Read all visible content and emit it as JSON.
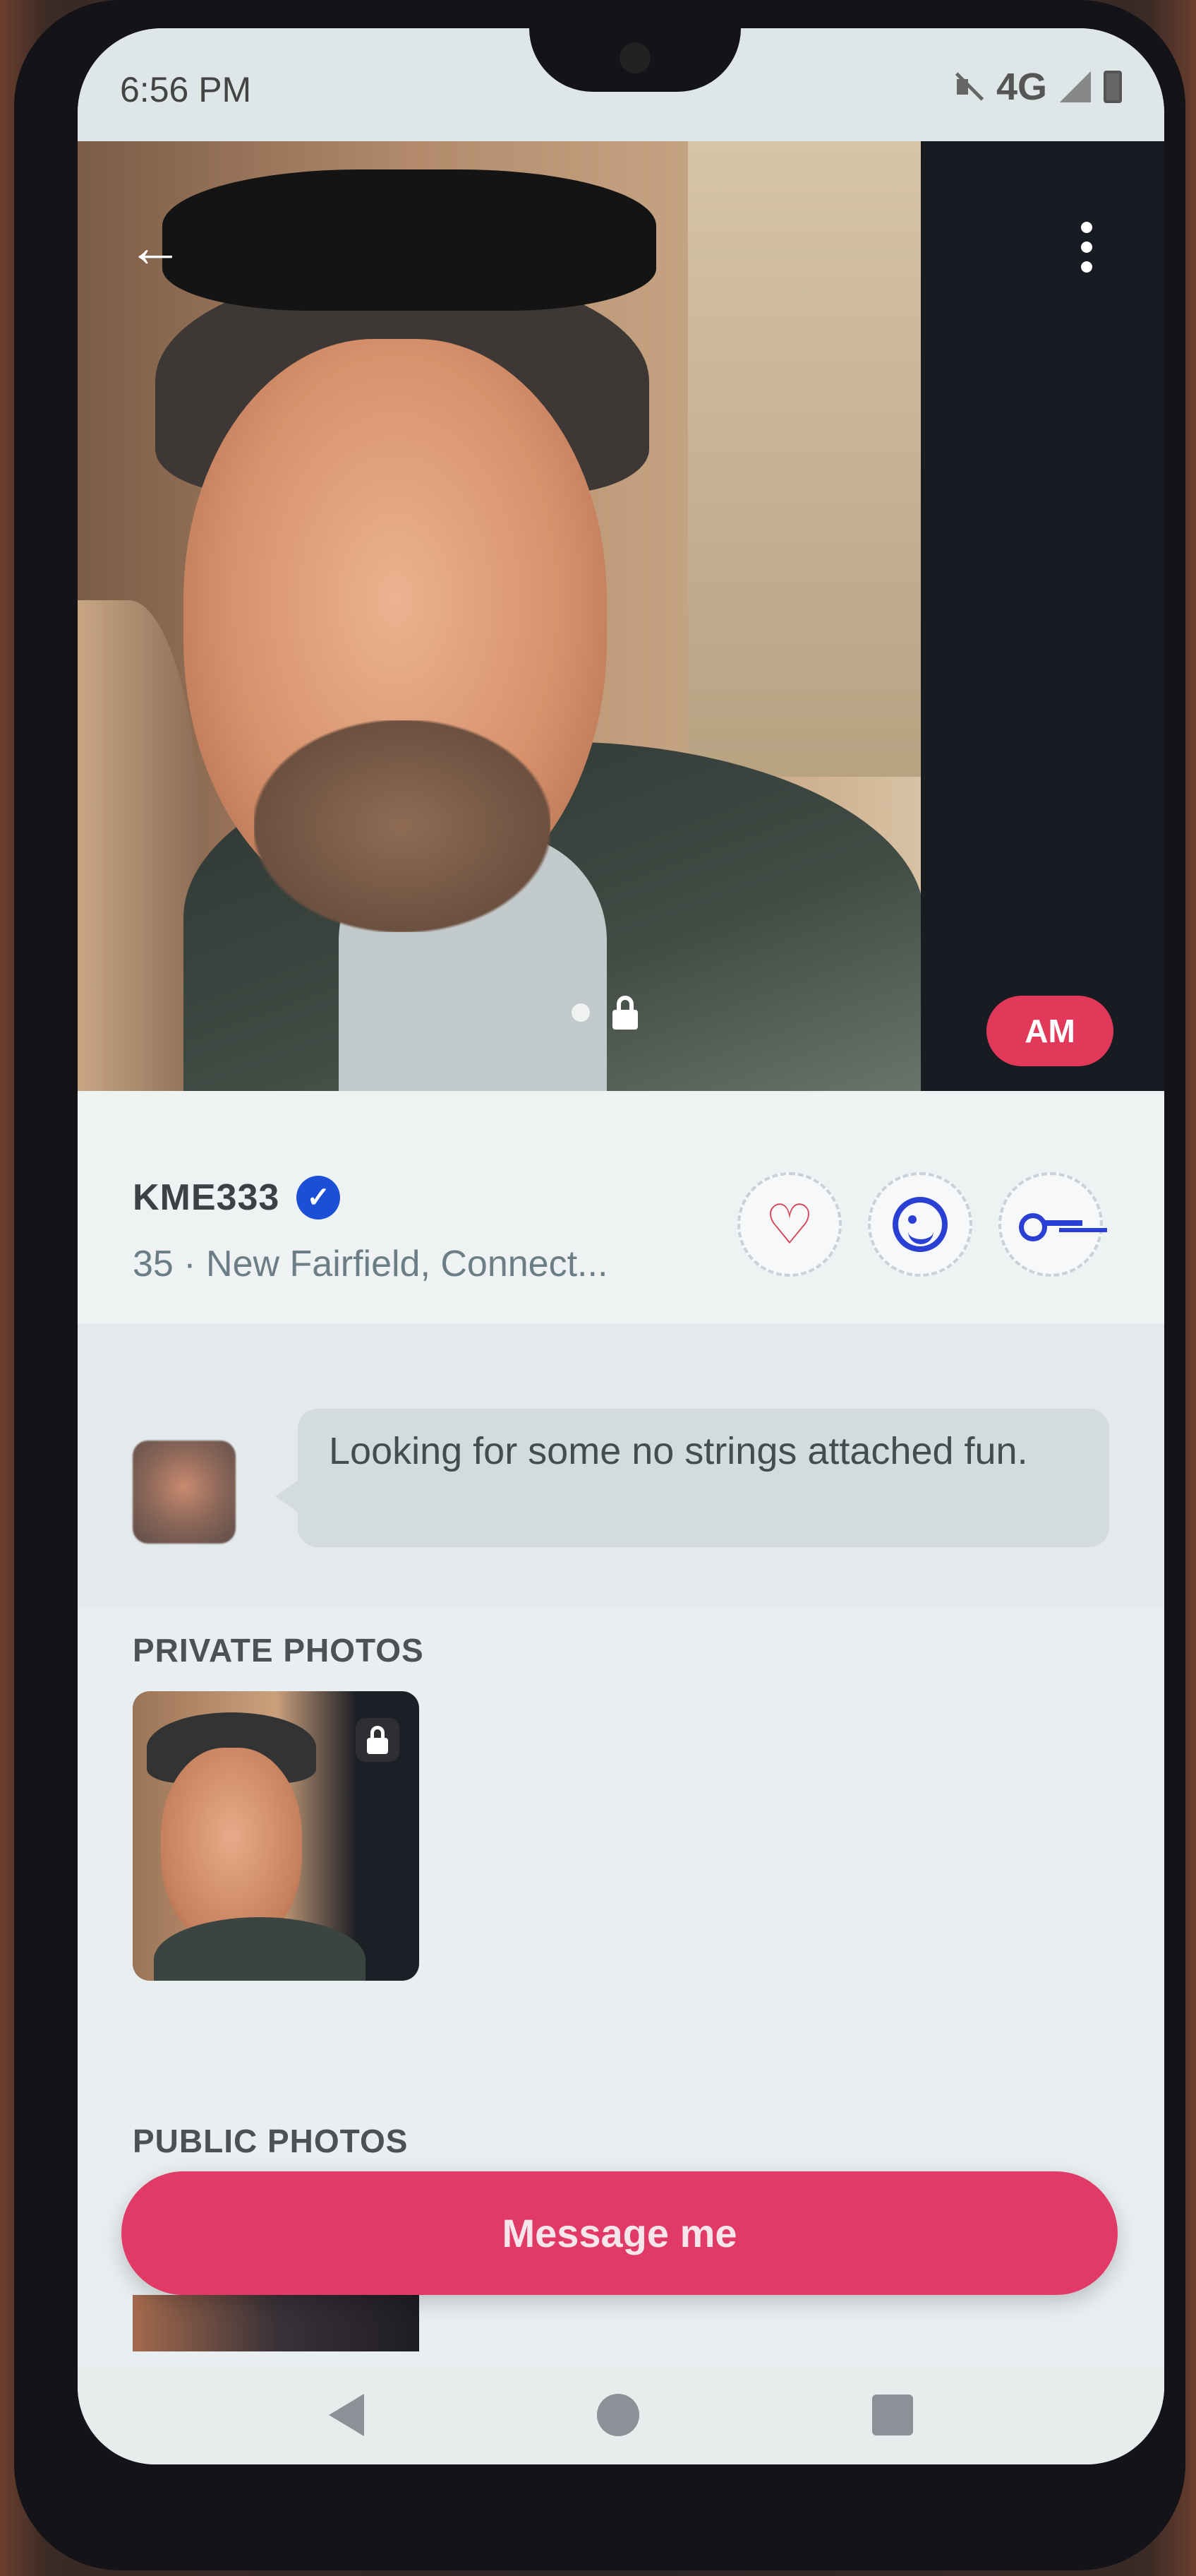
{
  "status_bar": {
    "time": "6:56 PM",
    "network": "4G",
    "icons": [
      "mute-icon",
      "signal-icon",
      "battery-icon"
    ]
  },
  "header": {
    "back_icon": "arrow-left-icon",
    "more_icon": "more-vertical-icon"
  },
  "hero": {
    "initials_badge": "AM",
    "indicator_icons": [
      "dot-icon",
      "lock-icon"
    ]
  },
  "profile": {
    "name": "KME333",
    "verified_icon": "verified-badge-icon",
    "subtitle": "35 · New Fairfield, Connect...",
    "actions": [
      {
        "name": "like",
        "icon": "heart-icon"
      },
      {
        "name": "wink",
        "icon": "wink-face-icon"
      },
      {
        "name": "key",
        "icon": "key-icon"
      }
    ]
  },
  "bio": {
    "text": "Looking for some no strings attached fun."
  },
  "sections": {
    "private_title": "PRIVATE PHOTOS",
    "public_title": "PUBLIC PHOTOS"
  },
  "cta": {
    "message_label": "Message me"
  },
  "colors": {
    "accent": "#e23a66",
    "badge": "#e2395a",
    "icon_blue": "#2a3fd3",
    "heart_red": "#d6485b"
  }
}
